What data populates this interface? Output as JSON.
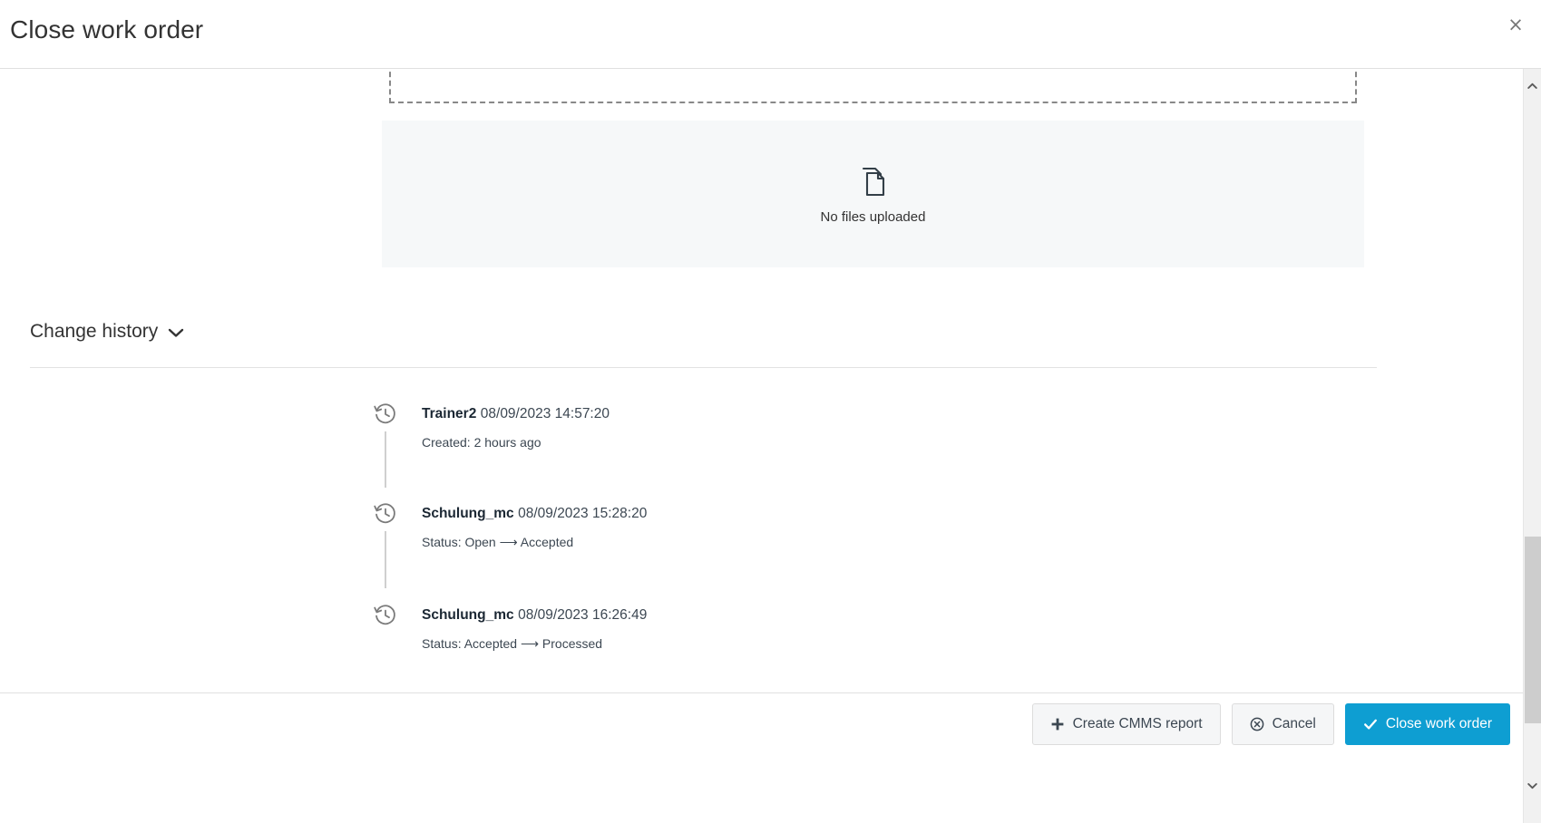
{
  "header": {
    "title": "Close work order",
    "close_icon": "close-icon",
    "close_label": "×"
  },
  "attachments": {
    "dropzone": {
      "name": "file-dropzone"
    },
    "empty_state": {
      "icon": "documents-icon",
      "text": "No files uploaded"
    }
  },
  "change_history": {
    "section_label": "Change history",
    "toggle_icon": "chevron-down-icon",
    "entries": [
      {
        "icon": "history-clock-icon",
        "user": "Trainer2",
        "timestamp": "08/09/2023 14:57:20",
        "detail": "Created: 2 hours ago"
      },
      {
        "icon": "history-clock-icon",
        "user": "Schulung_mc",
        "timestamp": "08/09/2023 15:28:20",
        "detail": "Status: Open ⟶ Accepted"
      },
      {
        "icon": "history-clock-icon",
        "user": "Schulung_mc",
        "timestamp": "08/09/2023 16:26:49",
        "detail": "Status: Accepted ⟶ Processed"
      }
    ]
  },
  "footer": {
    "create_report_label": "Create CMMS report",
    "create_report_icon": "plus-icon",
    "cancel_label": "Cancel",
    "cancel_icon": "cancel-circle-icon",
    "close_work_order_label": "Close work order",
    "close_work_order_icon": "check-icon"
  },
  "scrollbar": {
    "up_icon": "chevron-up-icon",
    "down_icon": "chevron-down-icon"
  },
  "colors": {
    "primary": "#0e9ed2",
    "panel_bg": "#f6f8f9",
    "text": "#333333",
    "muted": "#3c4752",
    "border": "#e0e0e0",
    "scroll_thumb": "#cdcdcd"
  }
}
